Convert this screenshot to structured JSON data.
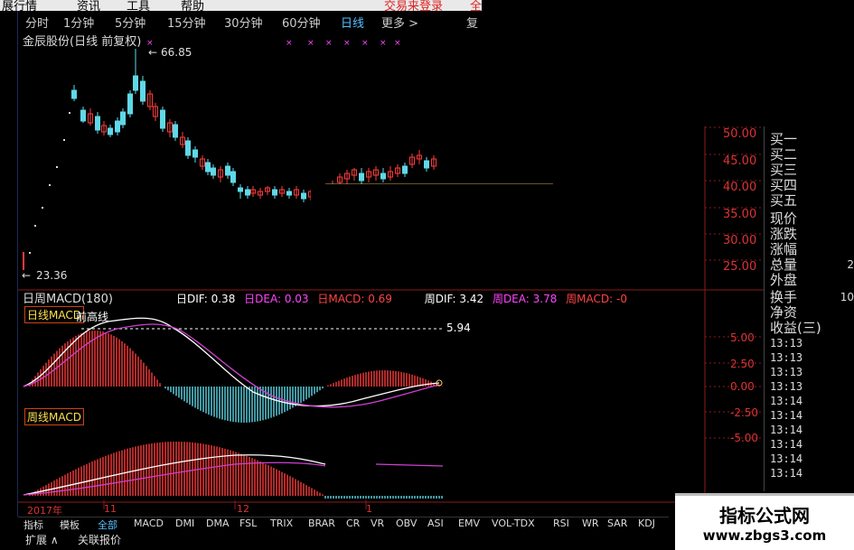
{
  "menubar": {
    "items": [
      "展行情",
      "资讯",
      "工具",
      "帮助"
    ],
    "right_label": "交易来登录",
    "right_extra": "全"
  },
  "periods": {
    "items": [
      "分时",
      "1分钟",
      "5分钟",
      "15分钟",
      "30分钟",
      "60分钟",
      "日线",
      "更多 >"
    ],
    "active": "日线",
    "right_tab": "复"
  },
  "chart": {
    "title": "金辰股份(日线 前复权)",
    "high_label": "66.85",
    "low_label": "23.36",
    "price_axis": [
      "50.00",
      "45.00",
      "40.00",
      "35.00",
      "30.00",
      "25.00"
    ],
    "macd_title": "日周MACD(180)",
    "macd_info": [
      {
        "text": "日DIF: 0.38",
        "color": "#ffffff"
      },
      {
        "text": "日DEA: 0.03",
        "color": "#ff44ff"
      },
      {
        "text": "日MACD: 0.69",
        "color": "#ff4444"
      },
      {
        "text": "周DIF: 3.42",
        "color": "#ffffff"
      },
      {
        "text": "周DEA: 3.78",
        "color": "#ff44ff"
      },
      {
        "text": "周MACD: -0",
        "color": "#ff4444"
      }
    ],
    "day_tag": "日线MACD",
    "week_tag": "周线MACD",
    "annotation_label": "前高线",
    "dashed_value": "5.94",
    "macd_axis": [
      "5.00",
      "2.50",
      "0.00",
      "-2.50",
      "-5.00"
    ],
    "date_labels": [
      "2017年",
      "11",
      "12",
      "1"
    ],
    "colors": {
      "up": "#ff3b3b",
      "down": "#5fd8e8",
      "dif": "#ffffff",
      "dea": "#d040d0",
      "grid": "#8b1a1a"
    }
  },
  "sidepanel": {
    "rows": [
      "买一",
      "买二",
      "买三",
      "买四",
      "买五",
      "现价",
      "涨跌",
      "涨幅",
      "总量",
      "外盘",
      "换手",
      "净资",
      "收益(三)"
    ],
    "right_values": {
      "total": "2",
      "turnover": "10"
    },
    "times": [
      "13:13",
      "13:13",
      "13:13",
      "13:13",
      "13:14",
      "13:14",
      "13:14",
      "13:14",
      "13:14",
      "13:14",
      "13:14",
      "13:14"
    ]
  },
  "indicators": {
    "items": [
      "指标",
      "模板",
      "全部",
      "MACD",
      "DMI",
      "DMA",
      "FSL",
      "TRIX",
      "BRAR",
      "CR",
      "VR",
      "OBV",
      "ASI",
      "EMV",
      "VOL-TDX",
      "RSI",
      "WR",
      "SAR",
      "KDJ"
    ],
    "active": "全部"
  },
  "bottom": {
    "items": [
      "扩展 ∧",
      "关联报价"
    ]
  },
  "watermark": {
    "title": "指标公式网",
    "url": "www.zbgs3.com"
  }
}
